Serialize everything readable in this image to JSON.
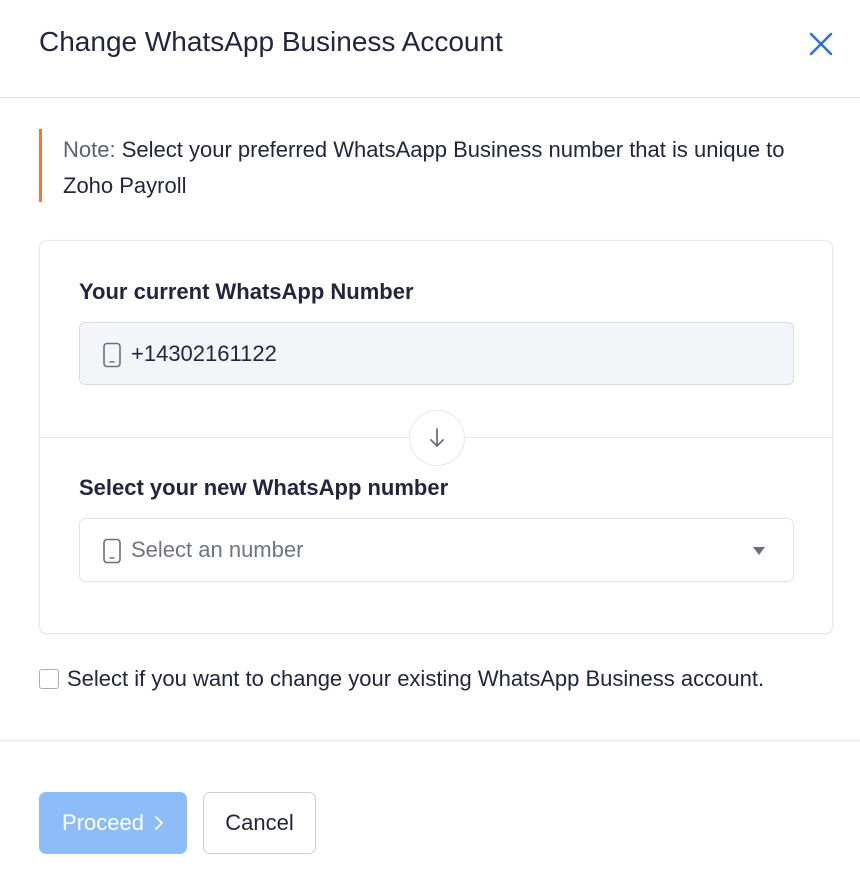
{
  "dialog": {
    "title": "Change WhatsApp Business Account"
  },
  "note": {
    "prefix": "Note:",
    "text": "Select your preferred WhatsAapp Business number that is unique to Zoho Payroll"
  },
  "current_number": {
    "label": "Your current WhatsApp Number",
    "value": "+14302161122",
    "icon": "phone-icon"
  },
  "new_number": {
    "label": "Select your new WhatsApp number",
    "placeholder": "Select an number",
    "icon": "phone-icon"
  },
  "swap_icon": "arrow-down-icon",
  "checkbox": {
    "label": "Select if you want to change your existing WhatsApp Business account.",
    "checked": false
  },
  "footer": {
    "proceed_label": "Proceed",
    "cancel_label": "Cancel"
  },
  "colors": {
    "accent": "#8cbdf9",
    "close_icon": "#2f74d0",
    "note_border": "#e8793f",
    "text": "#21263c"
  }
}
